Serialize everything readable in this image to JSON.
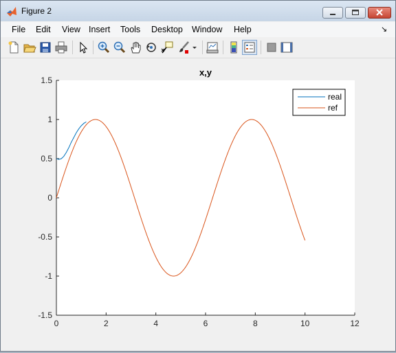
{
  "window": {
    "title": "Figure 2",
    "icon": "matlab-logo-icon",
    "controls": [
      "minimize-icon",
      "maximize-icon",
      "close-icon"
    ]
  },
  "menu": [
    "File",
    "Edit",
    "View",
    "Insert",
    "Tools",
    "Desktop",
    "Window",
    "Help"
  ],
  "toolbar": [
    "new-figure-icon",
    "open-file-icon",
    "save-icon",
    "print-icon",
    "select-arrow-icon",
    "zoom-in-icon",
    "zoom-out-icon",
    "pan-hand-icon",
    "rotate-3d-icon",
    "data-cursor-icon",
    "brush-icon",
    "brush-dropdown-icon",
    "link-plot-icon",
    "insert-colorbar-icon",
    "insert-legend-icon",
    "hide-plot-tools-icon",
    "show-plot-tools-icon"
  ],
  "chart_data": {
    "type": "line",
    "title": "x,y",
    "xlim": [
      0,
      12
    ],
    "ylim": [
      -1.5,
      1.5
    ],
    "xticks": [
      "0",
      "2",
      "4",
      "6",
      "8",
      "10",
      "12"
    ],
    "yticks": [
      "1.5",
      "1",
      "0.5",
      "0",
      "-0.5",
      "-1",
      "-1.5"
    ],
    "legend_position": "top-right",
    "grid": false,
    "series": [
      {
        "name": "real",
        "color": "#0072bd",
        "x": [
          0,
          0.1,
          0.2,
          0.3,
          0.4,
          0.5,
          0.6,
          0.7,
          0.8,
          0.9,
          1.0,
          1.1,
          1.2
        ],
        "y": [
          0.5,
          0.49,
          0.5,
          0.53,
          0.58,
          0.64,
          0.71,
          0.77,
          0.83,
          0.88,
          0.92,
          0.95,
          0.97
        ]
      },
      {
        "name": "ref",
        "color": "#d95319",
        "x_range": [
          0,
          10
        ],
        "function": "sin(x)"
      }
    ]
  }
}
